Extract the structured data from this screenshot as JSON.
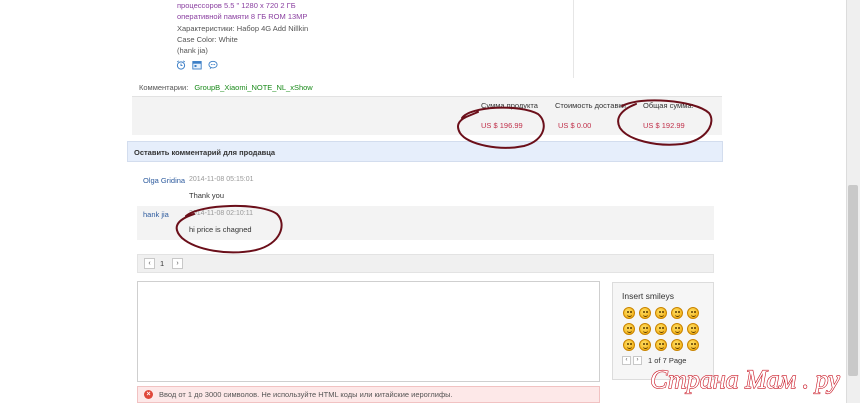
{
  "product": {
    "spec_lines": [
      "процессоров 5.5 \" 1280 x 720 2 ГБ",
      "оперативной памяти 8 ГБ ROM 13MP",
      "Характеристики: Набор 4G Add Nillkin",
      "Case    Color: White",
      "(hank jia)"
    ],
    "icons": [
      "alarm-clock-icon",
      "calendar-icon",
      "chat-icon"
    ]
  },
  "order_comment": {
    "label": "Комментарии:",
    "value": "GroupB_Xiaomi_NOTE_NL_xShow"
  },
  "totals": {
    "product_sum_label": "Сумма продукта",
    "product_sum_value": "US $ 196.99",
    "shipping_label": "Стоимость доставки",
    "shipping_value": "US $ 0.00",
    "total_label": "Общая сумма:",
    "total_value": "US $ 192.99"
  },
  "seller_comments": {
    "header": "Оставить комментарий для продавца",
    "messages": [
      {
        "author": "Olga Gridina",
        "date": "2014-11-08 05:15:01",
        "text": "Thank you"
      },
      {
        "author": "hank jia",
        "date": "2014-11-08 02:10:11",
        "text": "hi price is chagned"
      }
    ],
    "pager": {
      "prev": "‹",
      "page": "1",
      "next": "›"
    }
  },
  "smileys": {
    "title": "Insert smileys",
    "count": 15,
    "pager": {
      "prev": "‹",
      "next": "›",
      "text": "1 of 7 Page"
    }
  },
  "error_message": "Ввод от 1 до 3000 символов. Не используйте HTML коды или китайские иероглифы.",
  "watermark": "Страна Мам . ру",
  "colors": {
    "link_blue": "#2d5b9e",
    "price_red": "#c0304a",
    "annotation": "#6b0f1a",
    "header_blue": "#e6eefb"
  }
}
